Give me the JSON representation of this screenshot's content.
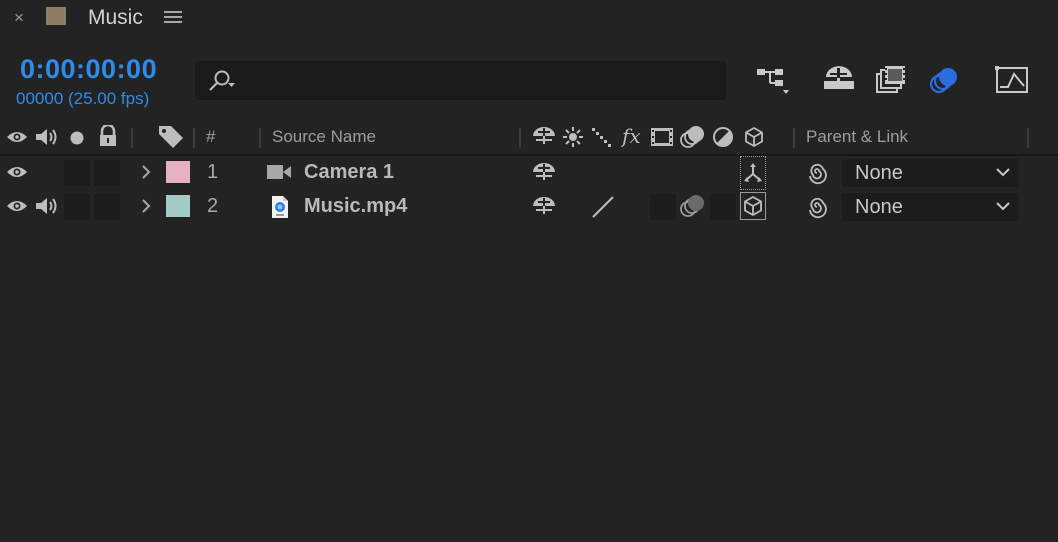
{
  "panel": {
    "close_glyph": "×",
    "tab_title": "Music",
    "tab_swatch_color": "#8e7c64",
    "menu_icon": "hamburger-icon"
  },
  "time": {
    "timecode": "0:00:00:00",
    "frames": "00000 (25.00 fps)",
    "color": "#2d8ceb"
  },
  "search": {
    "value": "",
    "placeholder": "",
    "icon": "search-icon"
  },
  "toolbar": {
    "icons": [
      "composition-flowchart-icon",
      "draft-3d-icon",
      "frame-blending-icon",
      "motion-blur-icon",
      "graph-editor-icon"
    ],
    "active_color": "#2d6cdf"
  },
  "columns": {
    "hash": "#",
    "source_name": "Source Name",
    "parent_link": "Parent & Link",
    "switch_icons": [
      "shy-icon",
      "collapse-icon",
      "quality-icon",
      "fx-icon",
      "frame-blend-icon",
      "motion-blur-icon",
      "adjustment-icon",
      "3d-layer-icon"
    ]
  },
  "layers": [
    {
      "number": "1",
      "name": "Camera 1",
      "label_color": "#e6b1c2",
      "type": "camera",
      "parent": "None"
    },
    {
      "number": "2",
      "name": "Music.mp4",
      "label_color": "#a3cbc5",
      "type": "footage",
      "parent": "None"
    }
  ]
}
